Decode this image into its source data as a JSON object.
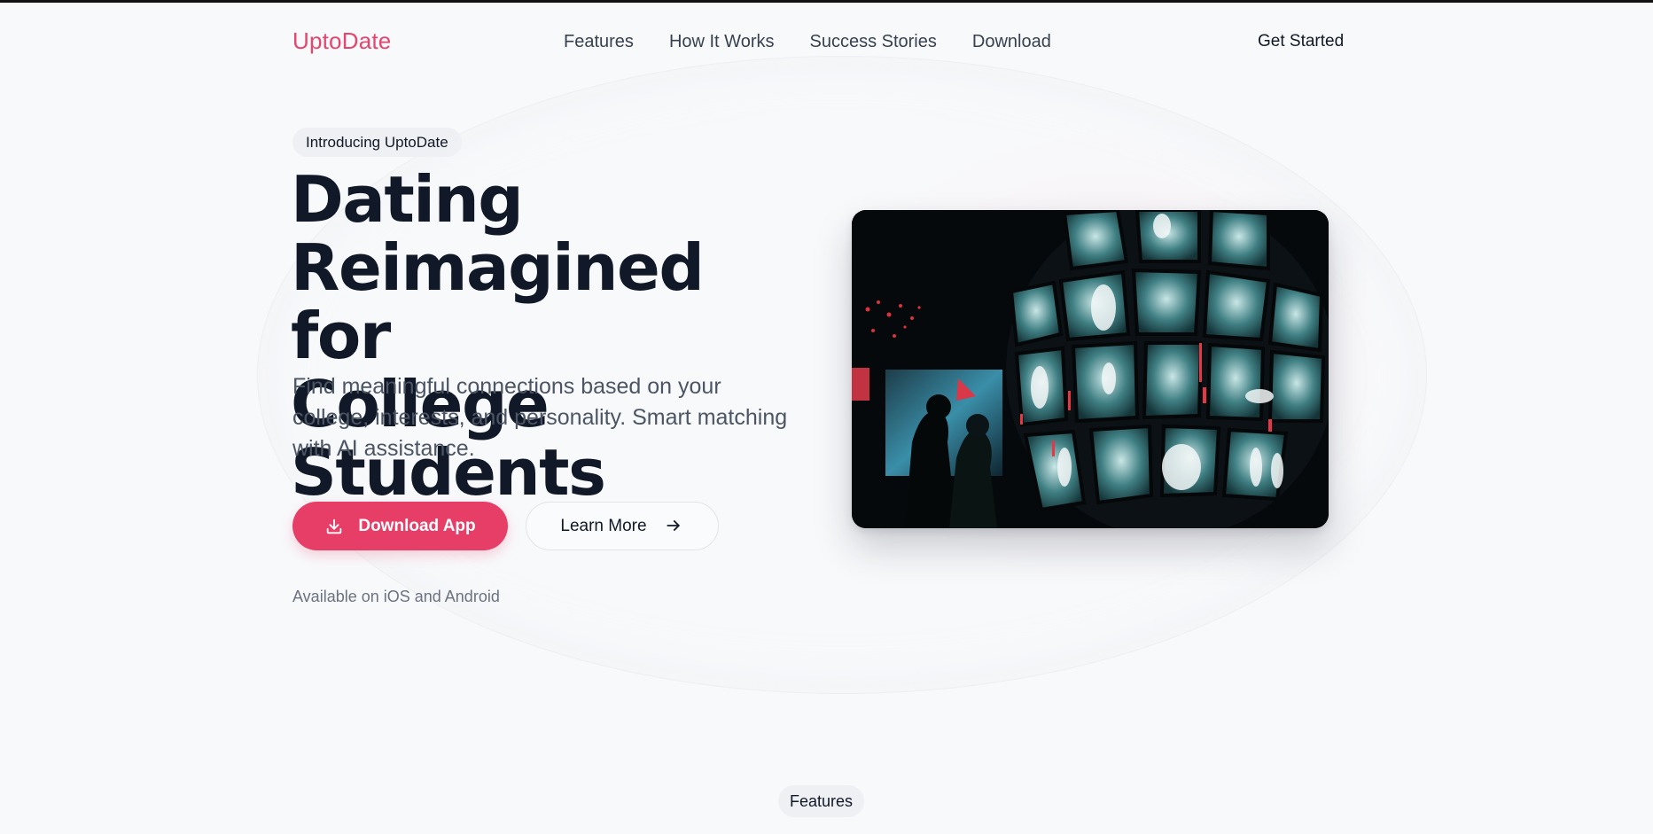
{
  "brand": {
    "name": "UptoDate",
    "accent": "#e63e67"
  },
  "nav": {
    "links": [
      "Features",
      "How It Works",
      "Success Stories",
      "Download"
    ],
    "cta": "Get Started"
  },
  "hero": {
    "badge": "Introducing UptoDate",
    "title_lines": [
      "Dating",
      "Reimagined for",
      "College Students"
    ],
    "subtitle": "Find meaningful connections based on your college, interests, and personality. Smart matching with AI assistance.",
    "primary_button": {
      "label": "Download App",
      "icon": "download-icon"
    },
    "secondary_button": {
      "label": "Learn More",
      "icon": "arrow-right-icon"
    },
    "availability": "Available on iOS and Android",
    "image_icon": "screens-installation-photo"
  },
  "sections": {
    "features_label": "Features"
  }
}
